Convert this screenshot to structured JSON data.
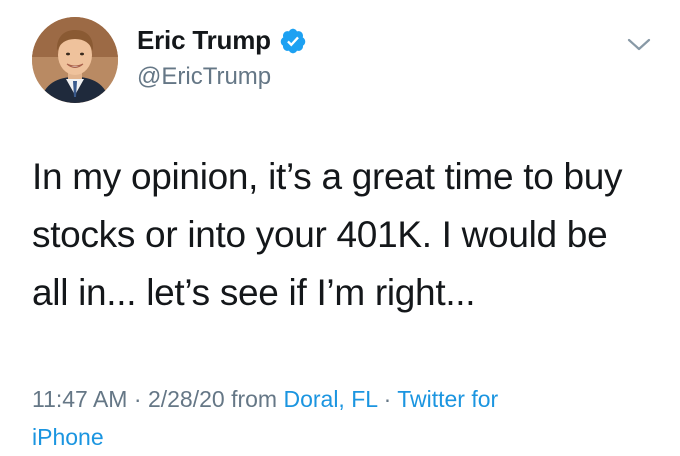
{
  "author": {
    "display_name": "Eric Trump",
    "handle": "@EricTrump",
    "verified": true,
    "verified_icon": "verified-badge-icon",
    "verified_color": "#1da1f2"
  },
  "tweet": {
    "lines": [
      "In my opinion, it’s a great time to buy",
      "stocks or into your 401K. I would be",
      "all in... let’s see if I’m right..."
    ]
  },
  "meta": {
    "time": "11:47 AM",
    "separator": " · ",
    "date": "2/28/20",
    "from_label": " from ",
    "location": "Doral, FL",
    "separator2": " · ",
    "source_line1": "Twitter for",
    "source_line2": "iPhone"
  },
  "colors": {
    "text_primary": "#14171a",
    "text_secondary": "#657786",
    "link": "#1b95e0",
    "background": "#ffffff"
  },
  "icons": {
    "menu": "chevron-down-icon"
  }
}
